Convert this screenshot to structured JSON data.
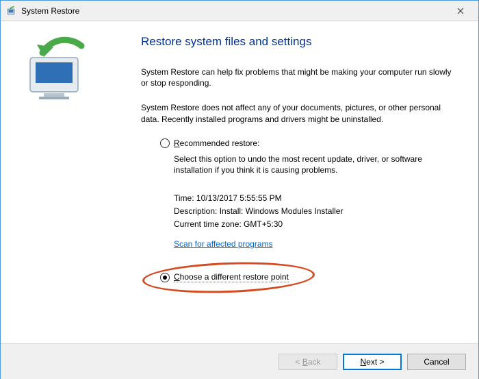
{
  "window": {
    "title": "System Restore"
  },
  "main": {
    "heading": "Restore system files and settings",
    "intro1": "System Restore can help fix problems that might be making your computer run slowly or stop responding.",
    "intro2": "System Restore does not affect any of your documents, pictures, or other personal data. Recently installed programs and drivers might be uninstalled.",
    "option1": {
      "label_prefix": "R",
      "label_rest": "ecommended restore:",
      "description": "Select this option to undo the most recent update, driver, or software installation if you think it is causing problems.",
      "time_label": "Time: ",
      "time_value": "10/13/2017 5:55:55 PM",
      "desc_label": "Description: ",
      "desc_value": "Install: Windows Modules Installer",
      "tz_label": "Current time zone: ",
      "tz_value": "GMT+5:30",
      "scan_link": "Scan for affected programs"
    },
    "option2": {
      "label_prefix": "C",
      "label_rest": "hoose a different restore point"
    }
  },
  "footer": {
    "back": "< Back",
    "next": "Next >",
    "cancel": "Cancel"
  }
}
